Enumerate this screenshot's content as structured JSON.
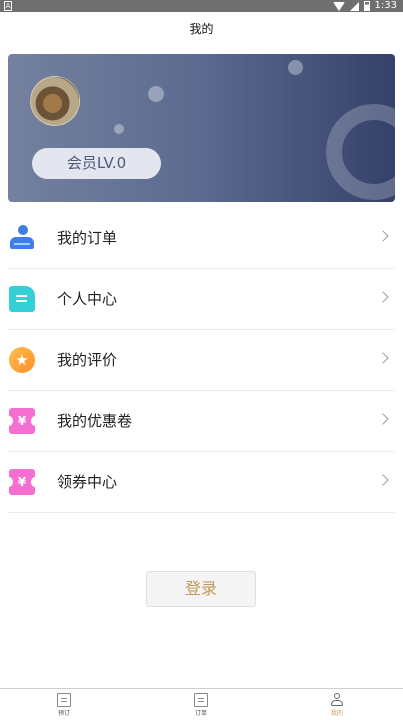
{
  "status_bar": {
    "time": "1:33",
    "left_icon": "A"
  },
  "header": {
    "title": "我的"
  },
  "profile": {
    "level_label": "会员LV.0"
  },
  "menu": [
    {
      "label": "我的订单",
      "icon": "user-order-icon"
    },
    {
      "label": "个人中心",
      "icon": "document-icon"
    },
    {
      "label": "我的评价",
      "icon": "star-badge-icon"
    },
    {
      "label": "我的优惠卷",
      "icon": "coupon-icon"
    },
    {
      "label": "领券中心",
      "icon": "coupon-icon"
    }
  ],
  "login": {
    "label": "登录"
  },
  "tabs": [
    {
      "label": "预订",
      "icon": "booking-icon"
    },
    {
      "label": "订单",
      "icon": "order-icon"
    },
    {
      "label": "我的",
      "icon": "profile-icon",
      "active": true
    }
  ],
  "colors": {
    "banner_start": "#74819f",
    "banner_end": "#35416a",
    "accent": "#c19a5a",
    "order_icon": "#3d7ee8",
    "personal_icon": "#34d0d6",
    "coupon_icon": "#f46fd0"
  }
}
